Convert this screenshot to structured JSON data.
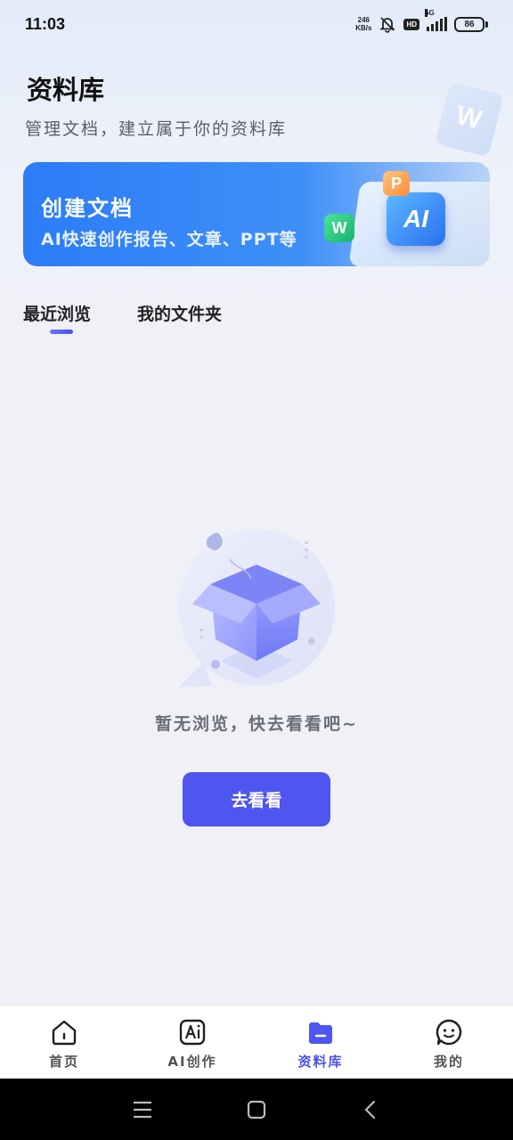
{
  "status_bar": {
    "time": "11:03",
    "net_speed_value": "246",
    "net_speed_unit": "KB/s",
    "hd": "HD",
    "network": "5G",
    "battery": "86"
  },
  "header": {
    "title": "资料库",
    "subtitle": "管理文档，建立属于你的资料库"
  },
  "create_card": {
    "title": "创建文档",
    "subtitle": "AI快速创作报告、文章、PPT等",
    "ai_key": "AI",
    "p_key": "P",
    "w_key": "W"
  },
  "deco_letter": "W",
  "tabs": [
    {
      "label": "最近浏览",
      "active": true
    },
    {
      "label": "我的文件夹",
      "active": false
    }
  ],
  "empty_state": {
    "message": "暂无浏览，快去看看吧~",
    "button": "去看看"
  },
  "bottom_nav": [
    {
      "label": "首页",
      "icon": "home-icon",
      "active": false
    },
    {
      "label": "AI创作",
      "icon": "ai-create-icon",
      "active": false
    },
    {
      "label": "资料库",
      "icon": "library-icon",
      "active": true
    },
    {
      "label": "我的",
      "icon": "profile-icon",
      "active": false
    }
  ],
  "colors": {
    "accent": "#4f55ef",
    "card_blue": "#2b7cf6",
    "background": "#f0f1f7"
  }
}
